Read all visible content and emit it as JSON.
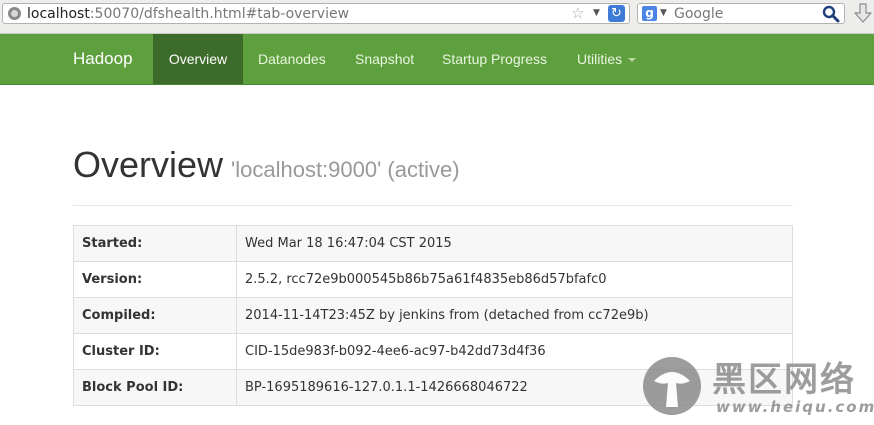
{
  "browser": {
    "url_host": "localhost",
    "url_rest": ":50070/dfshealth.html#tab-overview",
    "search_placeholder": "Google",
    "search_engine_letter": "g",
    "icons": [
      "site-icon",
      "bookmark-star-icon",
      "url-history-dropdown-icon",
      "reload-icon",
      "search-engine-icon",
      "magnifier-icon",
      "download-icon"
    ]
  },
  "navbar": {
    "brand": "Hadoop",
    "items": [
      {
        "label": "Overview",
        "active": true
      },
      {
        "label": "Datanodes",
        "active": false
      },
      {
        "label": "Snapshot",
        "active": false
      },
      {
        "label": "Startup Progress",
        "active": false
      },
      {
        "label": "Utilities",
        "active": false,
        "dropdown": true
      }
    ],
    "color": "#5ea03d",
    "active_color": "#3d6b2a"
  },
  "main": {
    "title": "Overview",
    "subtitle": "'localhost:9000' (active)",
    "rows": [
      {
        "key": "Started:",
        "value": "Wed Mar 18 16:47:04 CST 2015"
      },
      {
        "key": "Version:",
        "value": "2.5.2, rcc72e9b000545b86b75a61f4835eb86d57bfafc0"
      },
      {
        "key": "Compiled:",
        "value": "2014-11-14T23:45Z by jenkins from (detached from cc72e9b)"
      },
      {
        "key": "Cluster ID:",
        "value": "CID-15de983f-b092-4ee6-ac97-b42dd73d4f36"
      },
      {
        "key": "Block Pool ID:",
        "value": "BP-1695189616-127.0.1.1-1426668046722"
      }
    ]
  },
  "watermark": {
    "text_cn": "黑区网络",
    "url": "www.heiqu.com"
  }
}
